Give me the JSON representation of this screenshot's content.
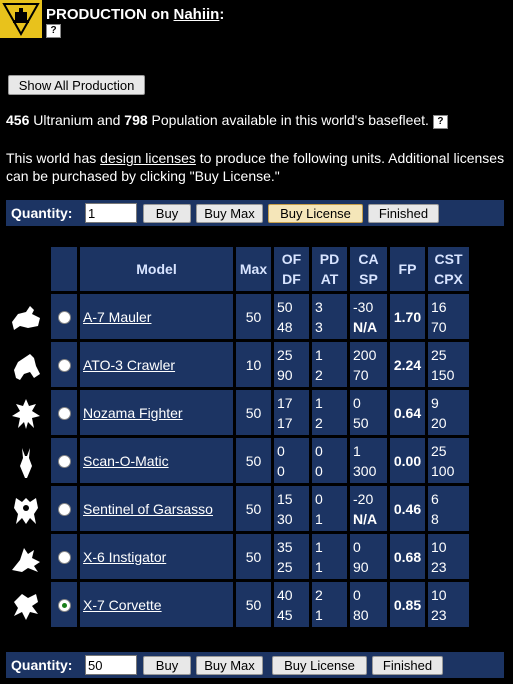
{
  "header": {
    "title_prefix": "PRODUCTION on ",
    "world": "Nahiin",
    "title_suffix": ":",
    "help_icon": "?"
  },
  "show_all_label": "Show All Production",
  "resources": {
    "ultranium": "456",
    "ultranium_text": " Ultranium and ",
    "population": "798",
    "population_text": " Population available in this world's basefleet.",
    "help_icon": "?"
  },
  "licenses": {
    "pre": "This world has ",
    "link": "design licenses",
    "post": " to produce the following units. Additional licenses can be purchased by clicking \"Buy License.\""
  },
  "quantity_top": {
    "label": "Quantity:",
    "value": "1",
    "buy": "Buy",
    "buy_max": "Buy Max",
    "buy_license": "Buy License",
    "finished": "Finished"
  },
  "quantity_bottom": {
    "label": "Quantity:",
    "value": "50",
    "buy": "Buy",
    "buy_max": "Buy Max",
    "buy_license": "Buy License",
    "finished": "Finished"
  },
  "table": {
    "headers": {
      "model": "Model",
      "max": "Max",
      "of": "OF",
      "df": "DF",
      "pd": "PD",
      "at": "AT",
      "ca": "CA",
      "sp": "SP",
      "fp": "FP",
      "cst": "CST",
      "cpx": "CPX"
    },
    "rows": [
      {
        "icon": "mauler-icon",
        "model": "A-7 Mauler",
        "max": "50",
        "of": "50",
        "df": "48",
        "pd": "3",
        "at": "3",
        "ca": "-30",
        "sp": "N/A",
        "fp": "1.70",
        "cst": "16",
        "cpx": "70",
        "selected": false
      },
      {
        "icon": "crawler-icon",
        "model": "ATO-3 Crawler",
        "max": "10",
        "of": "25",
        "df": "90",
        "pd": "1",
        "at": "2",
        "ca": "200",
        "sp": "70",
        "fp": "2.24",
        "cst": "25",
        "cpx": "150",
        "selected": false
      },
      {
        "icon": "fighter-icon",
        "model": "Nozama Fighter",
        "max": "50",
        "of": "17",
        "df": "17",
        "pd": "1",
        "at": "2",
        "ca": "0",
        "sp": "50",
        "fp": "0.64",
        "cst": "9",
        "cpx": "20",
        "selected": false
      },
      {
        "icon": "scanner-icon",
        "model": "Scan-O-Matic",
        "max": "50",
        "of": "0",
        "df": "0",
        "pd": "0",
        "at": "0",
        "ca": "1",
        "sp": "300",
        "fp": "0.00",
        "cst": "25",
        "cpx": "100",
        "selected": false
      },
      {
        "icon": "sentinel-icon",
        "model": "Sentinel of Garsasso",
        "max": "50",
        "of": "15",
        "df": "30",
        "pd": "0",
        "at": "1",
        "ca": "-20",
        "sp": "N/A",
        "fp": "0.46",
        "cst": "6",
        "cpx": "8",
        "selected": false
      },
      {
        "icon": "instigator-icon",
        "model": "X-6 Instigator",
        "max": "50",
        "of": "35",
        "df": "25",
        "pd": "1",
        "at": "1",
        "ca": "0",
        "sp": "90",
        "fp": "0.68",
        "cst": "10",
        "cpx": "23",
        "selected": false
      },
      {
        "icon": "corvette-icon",
        "model": "X-7 Corvette",
        "max": "50",
        "of": "40",
        "df": "45",
        "pd": "2",
        "at": "1",
        "ca": "0",
        "sp": "80",
        "fp": "0.85",
        "cst": "10",
        "cpx": "23",
        "selected": true
      }
    ]
  }
}
